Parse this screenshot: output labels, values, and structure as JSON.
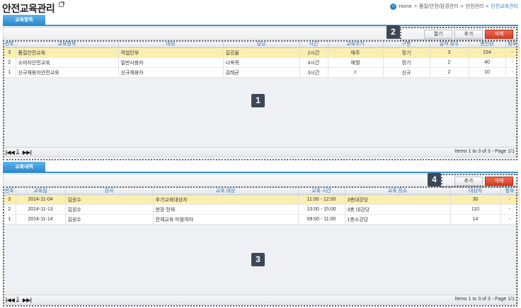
{
  "header": {
    "title": "안전교육관리",
    "breadcrumb": [
      "Home",
      "품질/안전/환경관리",
      "안전관리"
    ],
    "breadcrumb_current": "안전교육관리",
    "sep": ">"
  },
  "section1": {
    "tab": "교육항목",
    "buttons": {
      "open": "열기",
      "add": "추가",
      "delete": "삭제"
    },
    "columns": [
      "번호",
      "교육항목",
      "대상",
      "담당",
      "시간",
      "교육주기",
      "구분",
      "실적 횟수",
      "총인원",
      "첨부"
    ],
    "rows": [
      [
        "3",
        "품질안전교육",
        "작업인부",
        "김강율",
        "2시간",
        "매주",
        "정기",
        "3",
        "154",
        "-"
      ],
      [
        "2",
        "소비자안전교육",
        "일반사용자",
        "나옥목",
        "4시간",
        "매월",
        "정기",
        "2",
        "40",
        "-"
      ],
      [
        "1",
        "신규채용자안전교육",
        "신규채용자",
        "김태균",
        "3시간",
        "c",
        "신규",
        "2",
        "10",
        "-"
      ]
    ],
    "pager": {
      "first": "|◀◀",
      "page": "1",
      "last": "▶▶|",
      "info": "Items 1 to 3 of 3 - Page 1/1"
    }
  },
  "section2": {
    "tab": "교육내역",
    "buttons": {
      "add": "추가",
      "delete": "삭제"
    },
    "columns": [
      "번호",
      "교육일",
      "강사",
      "교육 대상",
      "교육 시간",
      "교육 장소",
      "대상자",
      "첨부"
    ],
    "rows": [
      [
        "3",
        "2014-11-04",
        "김원수",
        "추가교육대상자",
        "11:00 - 12:00",
        "3층대강당",
        "30",
        "-"
      ],
      [
        "2",
        "2014-11-13",
        "김원수",
        "현장 전체",
        "13:00 - 15:00",
        "3층 대강당",
        "110",
        "-"
      ],
      [
        "1",
        "2014-11-14",
        "김원수",
        "전체교육 미참여자",
        "09:00 - 11:00",
        "1층소강당",
        "14",
        "-"
      ]
    ],
    "pager": {
      "first": "|◀◀",
      "page": "1",
      "last": "▶▶|",
      "info": "Items 1 to 3 of 3 - Page 1/1"
    }
  },
  "annotations": [
    "1",
    "2",
    "3",
    "4"
  ]
}
